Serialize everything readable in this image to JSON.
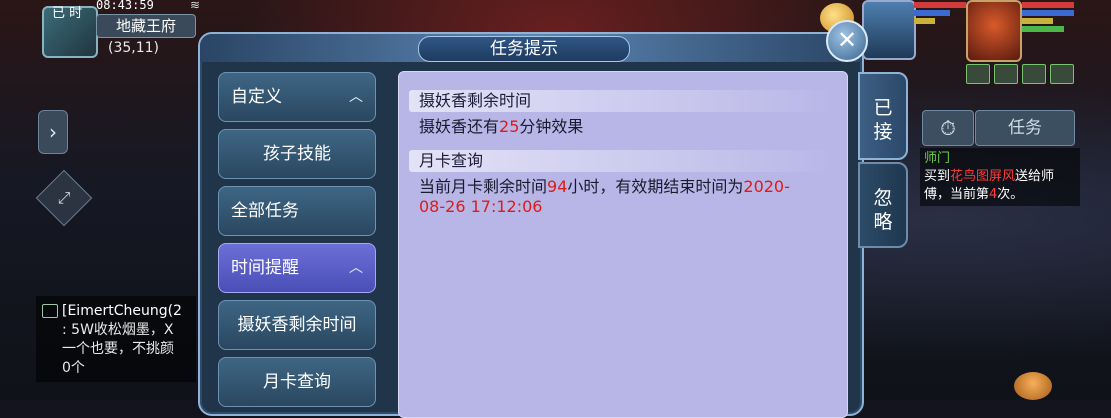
{
  "status": {
    "time_label": "已 时",
    "time": "08:43:59"
  },
  "location": {
    "name": "地藏王府",
    "coords": "(35,11)"
  },
  "chat": {
    "lines": [
      {
        "text": "[EimertCheung(2"
      },
      {
        "text": ": 5W收松烟墨，X"
      },
      {
        "text": "一个也要，不挑颜"
      },
      {
        "text": "0个"
      }
    ]
  },
  "mini_panel": {
    "task_button": "任务",
    "title": "师门",
    "body_prefix": "买到",
    "item": "花鸟图屏风",
    "body_mid": "送给师傅，当前第",
    "count": "4",
    "body_suffix": "次。"
  },
  "dialog": {
    "title": "任务提示",
    "menu": [
      {
        "label": "自定义",
        "type": "cat",
        "expanded": true
      },
      {
        "label": "孩子技能",
        "type": "sub"
      },
      {
        "label": "全部任务",
        "type": "cat"
      },
      {
        "label": "时间提醒",
        "type": "cat",
        "expanded": true,
        "active": true
      },
      {
        "label": "摄妖香剩余时间",
        "type": "sub"
      },
      {
        "label": "月卡查询",
        "type": "sub"
      }
    ],
    "sections": [
      {
        "header": "摄妖香剩余时间",
        "line_prefix": "摄妖香还有",
        "value": "25",
        "line_suffix": "分钟效果"
      },
      {
        "header": "月卡查询",
        "line_prefix": "当前月卡剩余时间",
        "value": "94",
        "line_mid": "小时，有效期结束时间为",
        "date_a": "2020-",
        "date_b": "08-26 17:12:06"
      }
    ],
    "tabs": [
      {
        "label": "已\n接"
      },
      {
        "label": "忽\n略"
      }
    ]
  },
  "colors": {
    "highlight": "#e01919",
    "accent_green": "#6ccf4e",
    "active_menu": "#5a5fd0"
  }
}
